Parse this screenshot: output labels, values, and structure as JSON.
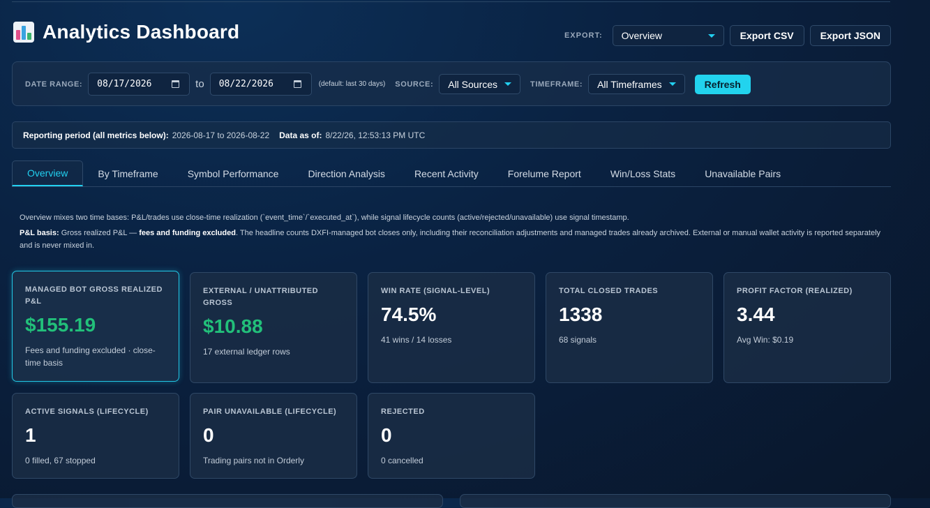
{
  "header": {
    "title": "Analytics Dashboard",
    "export_label": "EXPORT:",
    "export_select": "Overview",
    "export_csv": "Export CSV",
    "export_json": "Export JSON"
  },
  "filters": {
    "date_range_label": "DATE RANGE:",
    "date_from": "08/17/2026",
    "to_label": "to",
    "date_to": "08/22/2026",
    "default_hint": "(default: last 30 days)",
    "source_label": "SOURCE:",
    "source_value": "All Sources",
    "timeframe_label": "TIMEFRAME:",
    "timeframe_value": "All Timeframes",
    "refresh": "Refresh"
  },
  "period": {
    "reporting_label": "Reporting period (all metrics below):",
    "reporting_value": "2026-08-17 to 2026-08-22",
    "asof_label": "Data as of:",
    "asof_value": "8/22/26, 12:53:13 PM UTC"
  },
  "tabs": [
    "Overview",
    "By Timeframe",
    "Symbol Performance",
    "Direction Analysis",
    "Recent Activity",
    "Forelume Report",
    "Win/Loss Stats",
    "Unavailable Pairs"
  ],
  "notes": {
    "line1": "Overview mixes two time bases: P&L/trades use close-time realization (`event_time`/`executed_at`), while signal lifecycle counts (active/rejected/unavailable) use signal timestamp.",
    "basis_label": "P&L basis:",
    "basis_text1": "Gross realized P&L —",
    "basis_bold": "fees and funding excluded",
    "basis_text2": ". The headline counts DXFI-managed bot closes only, including their reconciliation adjustments and managed trades already archived. External or manual wallet activity is reported separately and is never mixed in."
  },
  "cards": [
    {
      "label": "MANAGED BOT GROSS REALIZED P&L",
      "value": "$155.19",
      "sub": "Fees and funding excluded · close-time basis"
    },
    {
      "label": "EXTERNAL / UNATTRIBUTED GROSS",
      "value": "$10.88",
      "sub": "17 external ledger rows"
    },
    {
      "label": "WIN RATE (SIGNAL-LEVEL)",
      "value": "74.5%",
      "sub": "41 wins / 14 losses"
    },
    {
      "label": "TOTAL CLOSED TRADES",
      "value": "1338",
      "sub": "68 signals"
    },
    {
      "label": "PROFIT FACTOR (REALIZED)",
      "value": "3.44",
      "sub": "Avg Win: $0.19"
    },
    {
      "label": "ACTIVE SIGNALS (LIFECYCLE)",
      "value": "1",
      "sub": "0 filled, 67 stopped"
    },
    {
      "label": "PAIR UNAVAILABLE (LIFECYCLE)",
      "value": "0",
      "sub": "Trading pairs not in Orderly"
    },
    {
      "label": "REJECTED",
      "value": "0",
      "sub": "0 cancelled"
    }
  ],
  "colors": {
    "accent": "#22d3ee",
    "positive": "#22c07a"
  }
}
